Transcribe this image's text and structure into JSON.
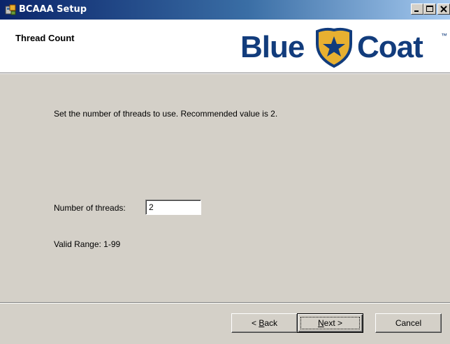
{
  "window": {
    "title": "BCAAA Setup",
    "controls": {
      "minimize": "minimize",
      "maximize": "maximize",
      "close": "close"
    }
  },
  "header": {
    "title": "Thread Count",
    "logo": {
      "left": "Blue",
      "right": "Coat",
      "trademark": "™"
    }
  },
  "main": {
    "instruction": "Set the number of threads to use.  Recommended value is 2.",
    "threads_label": "Number of threads:",
    "threads_value": "2",
    "valid_range": "Valid Range: 1-99"
  },
  "footer": {
    "back": {
      "prefix": "< ",
      "mnemonic": "B",
      "rest": "ack"
    },
    "next": {
      "mnemonic": "N",
      "rest": "ext >"
    },
    "cancel": "Cancel"
  },
  "colors": {
    "titlebar_start": "#0a246a",
    "titlebar_end": "#a6caf0",
    "logo_blue": "#123c7c",
    "badge_gold": "#e8b030",
    "dialog_bg": "#d4d0c8"
  }
}
